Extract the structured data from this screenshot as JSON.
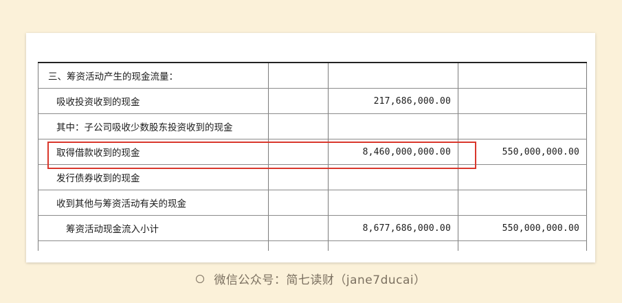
{
  "table": {
    "rows": [
      {
        "label": "三、筹资活动产生的现金流量：",
        "col2": "",
        "col3": "",
        "col4": ""
      },
      {
        "label": "吸收投资收到的现金",
        "col2": "",
        "col3": "217,686,000.00",
        "col4": ""
      },
      {
        "label": "其中：子公司吸收少数股东投资收到的现金",
        "col2": "",
        "col3": "",
        "col4": ""
      },
      {
        "label": "取得借款收到的现金",
        "col2": "",
        "col3": "8,460,000,000.00",
        "col4": "550,000,000.00"
      },
      {
        "label": "发行债券收到的现金",
        "col2": "",
        "col3": "",
        "col4": ""
      },
      {
        "label": "收到其他与筹资活动有关的现金",
        "col2": "",
        "col3": "",
        "col4": ""
      },
      {
        "label": "筹资活动现金流入小计",
        "col2": "",
        "col3": "8,677,686,000.00",
        "col4": "550,000,000.00"
      }
    ]
  },
  "highlight": {
    "color": "#d9362b"
  },
  "caption": {
    "text": "微信公众号：简七读财（jane7ducai）"
  },
  "colors": {
    "background": "#fbf1d9",
    "card": "#ffffff",
    "caption": "#7b7060"
  }
}
